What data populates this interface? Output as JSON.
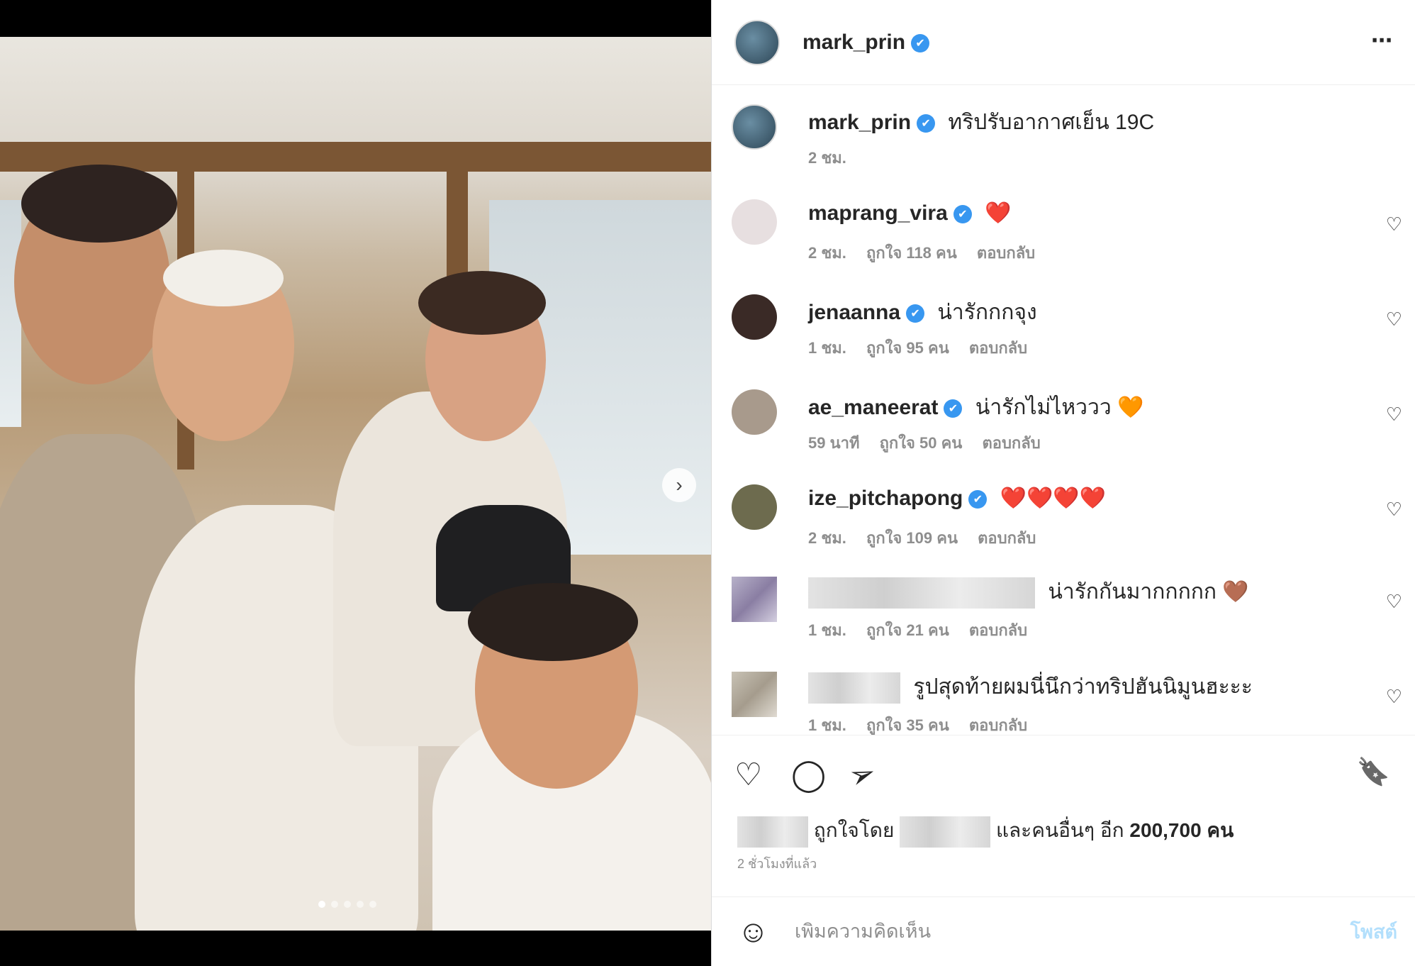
{
  "post": {
    "username": "mark_prin",
    "verified_mark": "✔",
    "more_icon": "⋯"
  },
  "caption": {
    "username": "mark_prin",
    "text": "ทริปรับอากาศเย็น 19C",
    "time": "2 ชม."
  },
  "comments": [
    {
      "username": "maprang_vira",
      "text": "❤️",
      "time": "2 ชม.",
      "likes": "ถูกใจ 118 คน",
      "reply": "ตอบกลับ",
      "avatar_color": "#e7dfe0"
    },
    {
      "username": "jenaanna",
      "text": "น่ารักกกจุง",
      "time": "1 ชม.",
      "likes": "ถูกใจ 95 คน",
      "reply": "ตอบกลับ",
      "avatar_color": "#3a2a26"
    },
    {
      "username": "ae_maneerat",
      "text": "น่ารักไม่ไหววว 🧡",
      "time": "59 นาที",
      "likes": "ถูกใจ 50 คน",
      "reply": "ตอบกลับ",
      "avatar_color": "#a89a8c"
    },
    {
      "username": "ize_pitchapong",
      "text": "❤️❤️❤️❤️",
      "time": "2 ชม.",
      "likes": "ถูกใจ 109 คน",
      "reply": "ตอบกลับ",
      "avatar_color": "#6d6b4e"
    },
    {
      "username": "",
      "text": "น่ารักกันมากกกกก 🤎",
      "time": "1 ชม.",
      "likes": "ถูกใจ 21 คน",
      "reply": "ตอบกลับ",
      "avatar_color": "#9b90b5"
    },
    {
      "username": "",
      "text": "รูปสุดท้ายผมนี่นึกว่าทริปฮันนิมูนฮะะะ",
      "time": "1 ชม.",
      "likes": "ถูกใจ 35 คน",
      "reply": "ตอบกลับ",
      "avatar_color": "#b9b3a8"
    }
  ],
  "actions": {
    "like_icon": "♡",
    "comment_icon": "◯",
    "share_icon": "➢",
    "save_icon": "🔖",
    "liked_by_prefix": "ถูกใจโดย",
    "liked_by_suffix": "และคนอื่นๆ อีก",
    "like_count": "200,700 คน",
    "timestamp": "2 ชั่วโมงที่แล้ว"
  },
  "composer": {
    "emoji_icon": "☺",
    "placeholder": "เพิ่มความคิดเห็น",
    "post_label": "โพสต์"
  },
  "carousel": {
    "next_icon": "›",
    "total_slides": 5,
    "active_slide": 1
  }
}
